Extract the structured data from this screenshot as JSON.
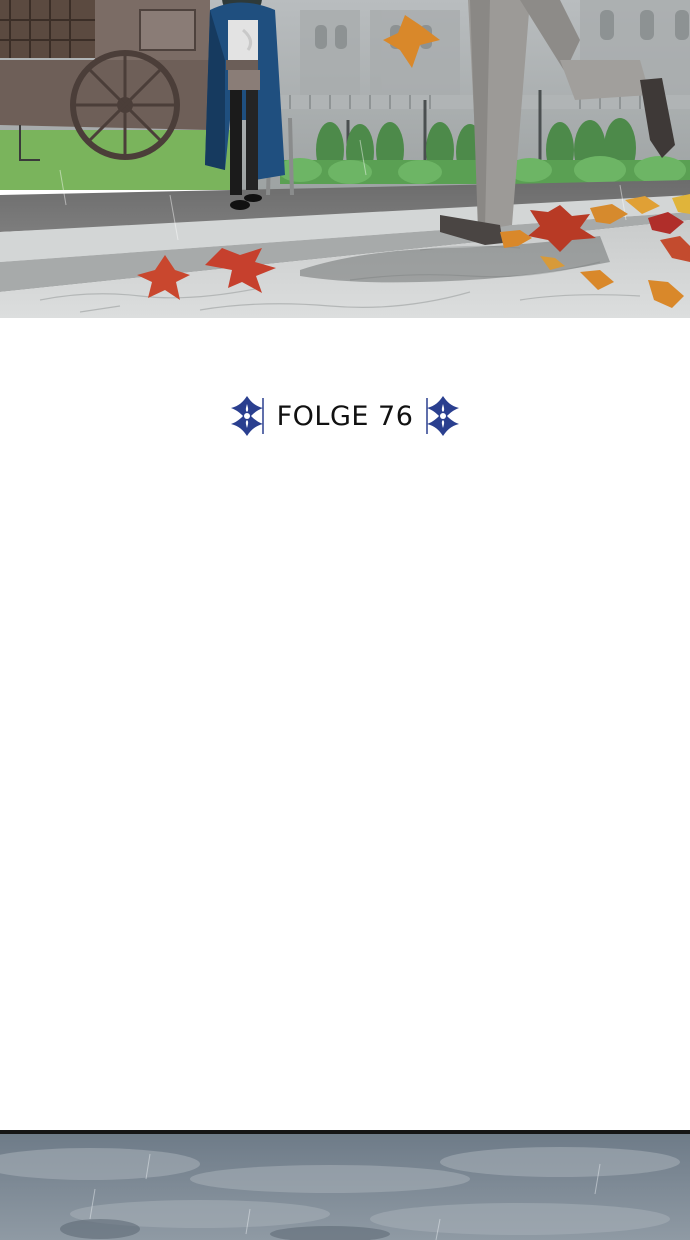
{
  "episode": {
    "title": "FOLGE 76"
  },
  "panels": {
    "top": {
      "description_icon": "courtyard-scene"
    },
    "bottom": {
      "description_icon": "rainy-sky-scene"
    }
  },
  "colors": {
    "cloak_blue": "#1f4f7f",
    "leaf_red": "#c9472e",
    "leaf_orange": "#d9882a",
    "ornament_blue": "#2a3f8f",
    "sky_grey": "#7d8a96"
  }
}
